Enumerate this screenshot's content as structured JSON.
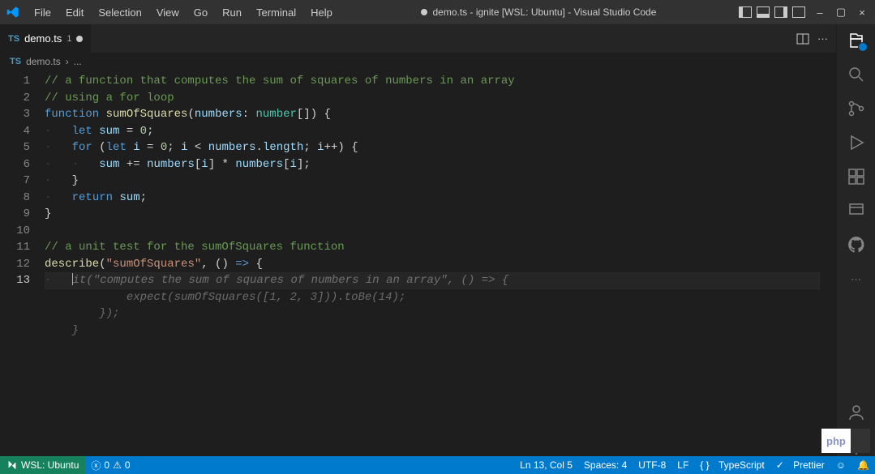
{
  "menu": [
    "File",
    "Edit",
    "Selection",
    "View",
    "Go",
    "Run",
    "Terminal",
    "Help"
  ],
  "title": "demo.ts - ignite [WSL: Ubuntu] - Visual Studio Code",
  "tab": {
    "file": "demo.ts",
    "modified_count": "1"
  },
  "breadcrumb": {
    "file": "demo.ts",
    "more": "..."
  },
  "remote": "WSL: Ubuntu",
  "status": {
    "errors": "0",
    "warnings": "0",
    "lncol": "Ln 13, Col 5",
    "spaces": "Spaces: 4",
    "enc": "UTF-8",
    "eol": "LF",
    "lang": "TypeScript",
    "prettier": "Prettier"
  },
  "code": {
    "lines": [
      {
        "n": "1",
        "t": "comment",
        "txt": "// a function that computes the sum of squares of numbers in an array"
      },
      {
        "n": "2",
        "t": "comment",
        "txt": "// using a for loop"
      },
      {
        "n": "3",
        "t": "code",
        "seg": [
          [
            "keyword",
            "function "
          ],
          [
            "func",
            "sumOfSquares"
          ],
          [
            "punc",
            "("
          ],
          [
            "var",
            "numbers"
          ],
          [
            "op",
            ": "
          ],
          [
            "type",
            "number"
          ],
          [
            "punc",
            "[]) {"
          ]
        ]
      },
      {
        "n": "4",
        "t": "code",
        "indent": 1,
        "seg": [
          [
            "keyword",
            "let "
          ],
          [
            "var",
            "sum"
          ],
          [
            "op",
            " = "
          ],
          [
            "num",
            "0"
          ],
          [
            "punc",
            ";"
          ]
        ]
      },
      {
        "n": "5",
        "t": "code",
        "indent": 1,
        "seg": [
          [
            "keyword",
            "for "
          ],
          [
            "punc",
            "("
          ],
          [
            "keyword",
            "let "
          ],
          [
            "var",
            "i"
          ],
          [
            "op",
            " = "
          ],
          [
            "num",
            "0"
          ],
          [
            "punc",
            "; "
          ],
          [
            "var",
            "i"
          ],
          [
            "op",
            " < "
          ],
          [
            "var",
            "numbers"
          ],
          [
            "punc",
            "."
          ],
          [
            "var",
            "length"
          ],
          [
            "punc",
            "; "
          ],
          [
            "var",
            "i"
          ],
          [
            "op",
            "++"
          ],
          [
            "punc",
            ") {"
          ]
        ]
      },
      {
        "n": "6",
        "t": "code",
        "indent": 2,
        "seg": [
          [
            "var",
            "sum"
          ],
          [
            "op",
            " += "
          ],
          [
            "var",
            "numbers"
          ],
          [
            "punc",
            "["
          ],
          [
            "var",
            "i"
          ],
          [
            "punc",
            "] "
          ],
          [
            "op",
            "*"
          ],
          [
            "punc",
            " "
          ],
          [
            "var",
            "numbers"
          ],
          [
            "punc",
            "["
          ],
          [
            "var",
            "i"
          ],
          [
            "punc",
            "];"
          ]
        ]
      },
      {
        "n": "7",
        "t": "code",
        "indent": 1,
        "seg": [
          [
            "punc",
            "}"
          ]
        ]
      },
      {
        "n": "8",
        "t": "code",
        "indent": 1,
        "seg": [
          [
            "keyword",
            "return "
          ],
          [
            "var",
            "sum"
          ],
          [
            "punc",
            ";"
          ]
        ]
      },
      {
        "n": "9",
        "t": "code",
        "seg": [
          [
            "punc",
            "}"
          ]
        ]
      },
      {
        "n": "10",
        "t": "blank"
      },
      {
        "n": "11",
        "t": "comment",
        "txt": "// a unit test for the sumOfSquares function"
      },
      {
        "n": "12",
        "t": "code",
        "seg": [
          [
            "func",
            "describe"
          ],
          [
            "punc",
            "("
          ],
          [
            "str",
            "\"sumOfSquares\""
          ],
          [
            "punc",
            ", () "
          ],
          [
            "keyword",
            "=>"
          ],
          [
            "punc",
            " {"
          ]
        ]
      },
      {
        "n": "13",
        "t": "current",
        "indent": 1,
        "ghost": "it(\"computes the sum of squares of numbers in an array\", () => {"
      },
      {
        "n": "",
        "t": "ghost",
        "indent": 2,
        "ghost": "expect(sumOfSquares([1, 2, 3])).toBe(14);"
      },
      {
        "n": "",
        "t": "ghost",
        "indent": 1,
        "ghost": "});"
      },
      {
        "n": "",
        "t": "ghost",
        "indent": 0,
        "ghost": "}"
      }
    ]
  }
}
